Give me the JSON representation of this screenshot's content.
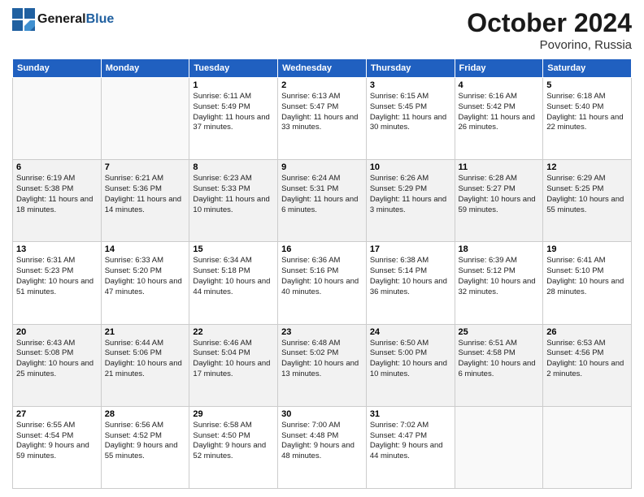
{
  "header": {
    "logo_line1": "General",
    "logo_line2": "Blue",
    "month": "October 2024",
    "location": "Povorino, Russia"
  },
  "weekdays": [
    "Sunday",
    "Monday",
    "Tuesday",
    "Wednesday",
    "Thursday",
    "Friday",
    "Saturday"
  ],
  "weeks": [
    [
      {
        "day": "",
        "info": ""
      },
      {
        "day": "",
        "info": ""
      },
      {
        "day": "1",
        "info": "Sunrise: 6:11 AM\nSunset: 5:49 PM\nDaylight: 11 hours and 37 minutes."
      },
      {
        "day": "2",
        "info": "Sunrise: 6:13 AM\nSunset: 5:47 PM\nDaylight: 11 hours and 33 minutes."
      },
      {
        "day": "3",
        "info": "Sunrise: 6:15 AM\nSunset: 5:45 PM\nDaylight: 11 hours and 30 minutes."
      },
      {
        "day": "4",
        "info": "Sunrise: 6:16 AM\nSunset: 5:42 PM\nDaylight: 11 hours and 26 minutes."
      },
      {
        "day": "5",
        "info": "Sunrise: 6:18 AM\nSunset: 5:40 PM\nDaylight: 11 hours and 22 minutes."
      }
    ],
    [
      {
        "day": "6",
        "info": "Sunrise: 6:19 AM\nSunset: 5:38 PM\nDaylight: 11 hours and 18 minutes."
      },
      {
        "day": "7",
        "info": "Sunrise: 6:21 AM\nSunset: 5:36 PM\nDaylight: 11 hours and 14 minutes."
      },
      {
        "day": "8",
        "info": "Sunrise: 6:23 AM\nSunset: 5:33 PM\nDaylight: 11 hours and 10 minutes."
      },
      {
        "day": "9",
        "info": "Sunrise: 6:24 AM\nSunset: 5:31 PM\nDaylight: 11 hours and 6 minutes."
      },
      {
        "day": "10",
        "info": "Sunrise: 6:26 AM\nSunset: 5:29 PM\nDaylight: 11 hours and 3 minutes."
      },
      {
        "day": "11",
        "info": "Sunrise: 6:28 AM\nSunset: 5:27 PM\nDaylight: 10 hours and 59 minutes."
      },
      {
        "day": "12",
        "info": "Sunrise: 6:29 AM\nSunset: 5:25 PM\nDaylight: 10 hours and 55 minutes."
      }
    ],
    [
      {
        "day": "13",
        "info": "Sunrise: 6:31 AM\nSunset: 5:23 PM\nDaylight: 10 hours and 51 minutes."
      },
      {
        "day": "14",
        "info": "Sunrise: 6:33 AM\nSunset: 5:20 PM\nDaylight: 10 hours and 47 minutes."
      },
      {
        "day": "15",
        "info": "Sunrise: 6:34 AM\nSunset: 5:18 PM\nDaylight: 10 hours and 44 minutes."
      },
      {
        "day": "16",
        "info": "Sunrise: 6:36 AM\nSunset: 5:16 PM\nDaylight: 10 hours and 40 minutes."
      },
      {
        "day": "17",
        "info": "Sunrise: 6:38 AM\nSunset: 5:14 PM\nDaylight: 10 hours and 36 minutes."
      },
      {
        "day": "18",
        "info": "Sunrise: 6:39 AM\nSunset: 5:12 PM\nDaylight: 10 hours and 32 minutes."
      },
      {
        "day": "19",
        "info": "Sunrise: 6:41 AM\nSunset: 5:10 PM\nDaylight: 10 hours and 28 minutes."
      }
    ],
    [
      {
        "day": "20",
        "info": "Sunrise: 6:43 AM\nSunset: 5:08 PM\nDaylight: 10 hours and 25 minutes."
      },
      {
        "day": "21",
        "info": "Sunrise: 6:44 AM\nSunset: 5:06 PM\nDaylight: 10 hours and 21 minutes."
      },
      {
        "day": "22",
        "info": "Sunrise: 6:46 AM\nSunset: 5:04 PM\nDaylight: 10 hours and 17 minutes."
      },
      {
        "day": "23",
        "info": "Sunrise: 6:48 AM\nSunset: 5:02 PM\nDaylight: 10 hours and 13 minutes."
      },
      {
        "day": "24",
        "info": "Sunrise: 6:50 AM\nSunset: 5:00 PM\nDaylight: 10 hours and 10 minutes."
      },
      {
        "day": "25",
        "info": "Sunrise: 6:51 AM\nSunset: 4:58 PM\nDaylight: 10 hours and 6 minutes."
      },
      {
        "day": "26",
        "info": "Sunrise: 6:53 AM\nSunset: 4:56 PM\nDaylight: 10 hours and 2 minutes."
      }
    ],
    [
      {
        "day": "27",
        "info": "Sunrise: 6:55 AM\nSunset: 4:54 PM\nDaylight: 9 hours and 59 minutes."
      },
      {
        "day": "28",
        "info": "Sunrise: 6:56 AM\nSunset: 4:52 PM\nDaylight: 9 hours and 55 minutes."
      },
      {
        "day": "29",
        "info": "Sunrise: 6:58 AM\nSunset: 4:50 PM\nDaylight: 9 hours and 52 minutes."
      },
      {
        "day": "30",
        "info": "Sunrise: 7:00 AM\nSunset: 4:48 PM\nDaylight: 9 hours and 48 minutes."
      },
      {
        "day": "31",
        "info": "Sunrise: 7:02 AM\nSunset: 4:47 PM\nDaylight: 9 hours and 44 minutes."
      },
      {
        "day": "",
        "info": ""
      },
      {
        "day": "",
        "info": ""
      }
    ]
  ]
}
